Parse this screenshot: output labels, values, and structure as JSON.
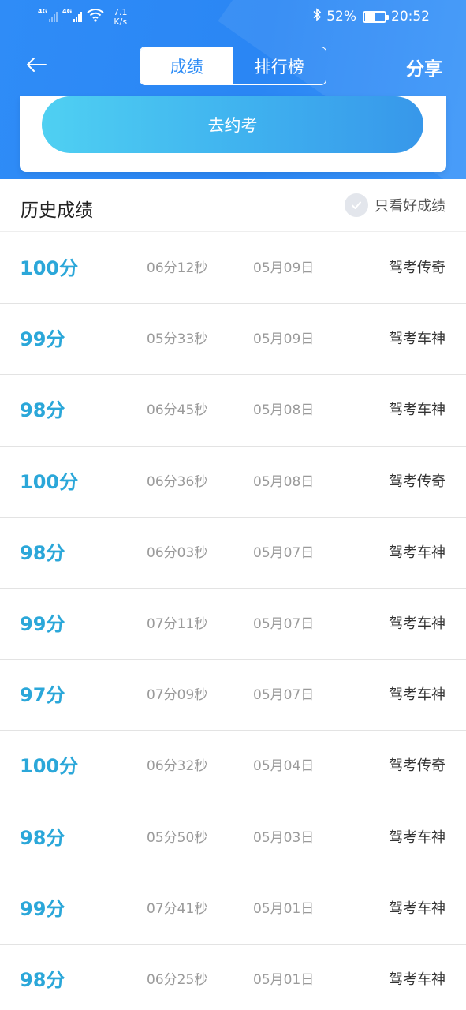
{
  "status_bar": {
    "network_1": "4G",
    "network_2": "4G",
    "speed_value": "7.1",
    "speed_unit": "K/s",
    "battery_percent": "52%",
    "battery_level": 0.52,
    "time": "20:52"
  },
  "nav": {
    "tabs": [
      {
        "label": "成绩",
        "active": true
      },
      {
        "label": "排行榜",
        "active": false
      }
    ],
    "share_label": "分享"
  },
  "card": {
    "book_exam_label": "去约考"
  },
  "history": {
    "title": "历史成绩",
    "filter_label": "只看好成绩",
    "records": [
      {
        "score": "100分",
        "duration": "06分12秒",
        "date": "05月09日",
        "title": "驾考传奇"
      },
      {
        "score": "99分",
        "duration": "05分33秒",
        "date": "05月09日",
        "title": "驾考车神"
      },
      {
        "score": "98分",
        "duration": "06分45秒",
        "date": "05月08日",
        "title": "驾考车神"
      },
      {
        "score": "100分",
        "duration": "06分36秒",
        "date": "05月08日",
        "title": "驾考传奇"
      },
      {
        "score": "98分",
        "duration": "06分03秒",
        "date": "05月07日",
        "title": "驾考车神"
      },
      {
        "score": "99分",
        "duration": "07分11秒",
        "date": "05月07日",
        "title": "驾考车神"
      },
      {
        "score": "97分",
        "duration": "07分09秒",
        "date": "05月07日",
        "title": "驾考车神"
      },
      {
        "score": "100分",
        "duration": "06分32秒",
        "date": "05月04日",
        "title": "驾考传奇"
      },
      {
        "score": "98分",
        "duration": "05分50秒",
        "date": "05月03日",
        "title": "驾考车神"
      },
      {
        "score": "99分",
        "duration": "07分41秒",
        "date": "05月01日",
        "title": "驾考车神"
      },
      {
        "score": "98分",
        "duration": "06分25秒",
        "date": "05月01日",
        "title": "驾考车神"
      }
    ]
  }
}
